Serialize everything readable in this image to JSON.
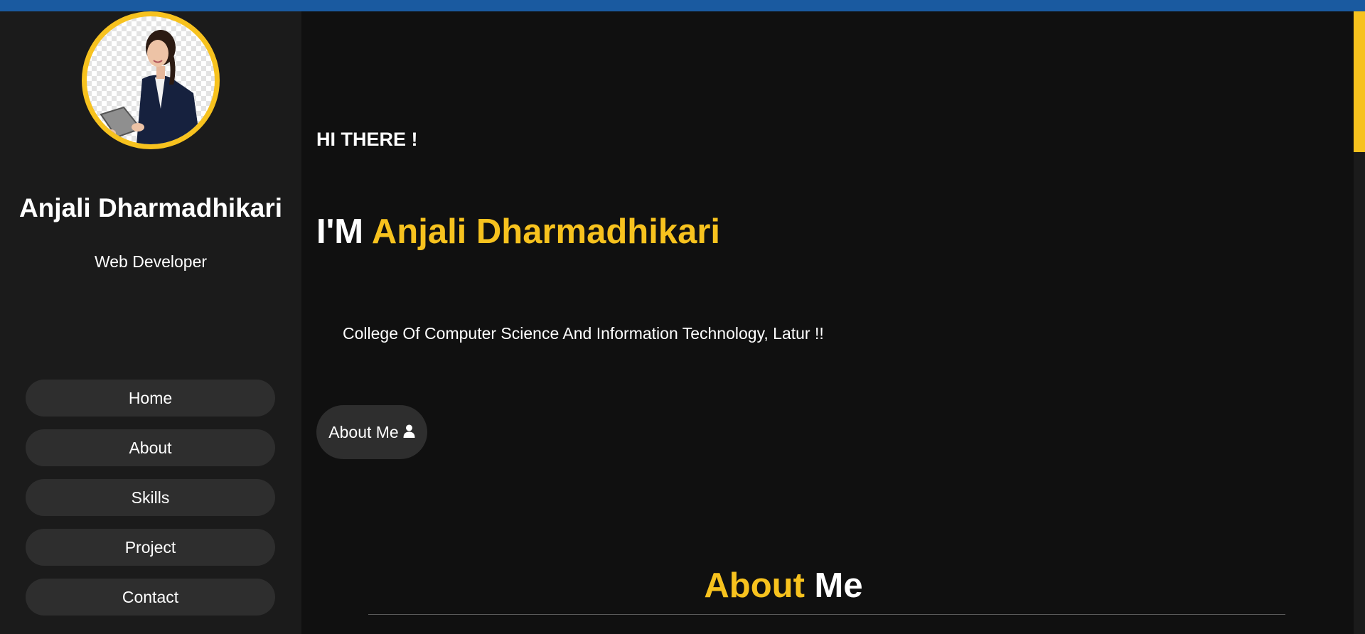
{
  "colors": {
    "accent": "#f7c21e",
    "topbar": "#1a5aa0",
    "background": "#101010",
    "sidebar": "#1b1b1b",
    "pill": "#2e2e2e"
  },
  "sidebar": {
    "profile_name": "Anjali Dharmadhikari",
    "profile_role": "Web Developer",
    "nav": [
      "Home",
      "About",
      "Skills",
      "Project",
      "Contact"
    ]
  },
  "hero": {
    "greeting": "HI THERE !",
    "headline_prefix": "I'M",
    "headline_name": "Anjali Dharmadhikari",
    "college": "College Of Computer Science And Information Technology, Latur !!",
    "about_button": "About Me",
    "about_button_icon": "user-icon"
  },
  "about_section": {
    "title_accent": "About",
    "title_plain": "Me"
  }
}
